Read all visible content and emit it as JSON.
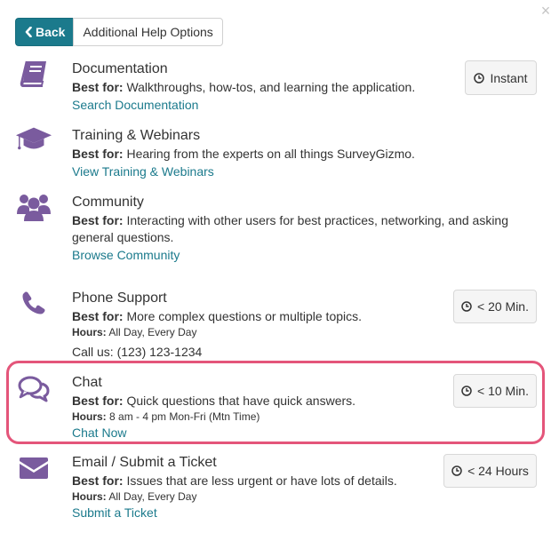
{
  "header": {
    "back_label": "Back",
    "title": "Additional Help Options",
    "close_glyph": "×"
  },
  "best_for_label": "Best for:",
  "hours_label": "Hours:",
  "items": [
    {
      "title": "Documentation",
      "best_for": "Walkthroughs, how-tos, and learning the application.",
      "link": "Search Documentation",
      "badge": "Instant",
      "icon": "book-icon"
    },
    {
      "title": "Training & Webinars",
      "best_for": "Hearing from the experts on all things SurveyGizmo.",
      "link": "View Training & Webinars",
      "icon": "graduation-cap-icon"
    },
    {
      "title": "Community",
      "best_for": "Interacting with other users for best practices, networking, and asking general questions.",
      "link": "Browse Community",
      "icon": "users-icon"
    },
    {
      "title": "Phone Support",
      "best_for": "More complex questions or multiple topics.",
      "hours": "All Day, Every Day",
      "call": "Call us: (123) 123-1234",
      "badge": "< 20 Min.",
      "icon": "phone-icon"
    },
    {
      "title": "Chat",
      "best_for": "Quick questions that have quick answers.",
      "hours": "8 am - 4 pm Mon-Fri (Mtn Time)",
      "link": "Chat Now",
      "badge": "< 10 Min.",
      "icon": "chat-bubbles-icon"
    },
    {
      "title": "Email / Submit a Ticket",
      "best_for": "Issues that are less urgent or have lots of details.",
      "hours": "All Day, Every Day",
      "link": "Submit a Ticket",
      "badge": "< 24 Hours",
      "icon": "envelope-icon"
    }
  ],
  "colors": {
    "icon_purple": "#7a5b9e",
    "link_teal": "#1b7a8c",
    "back_button": "#1b7a8c",
    "highlight": "#e4557a"
  }
}
